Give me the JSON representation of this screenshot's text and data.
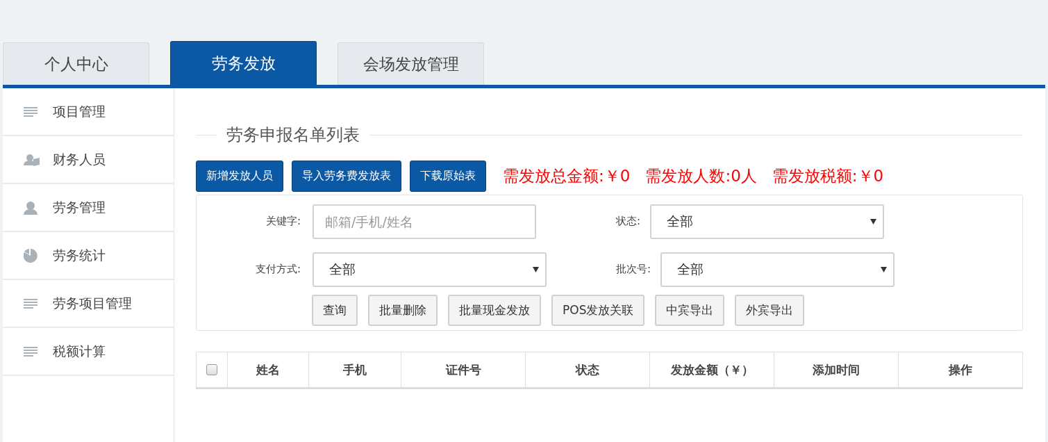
{
  "tabs": [
    {
      "label": "个人中心",
      "selected": false
    },
    {
      "label": "劳务发放",
      "selected": true
    },
    {
      "label": "会场发放管理",
      "selected": false
    }
  ],
  "sidebar": {
    "items": [
      {
        "label": "项目管理"
      },
      {
        "label": "财务人员"
      },
      {
        "label": "劳务管理"
      },
      {
        "label": "劳务统计"
      },
      {
        "label": "劳务项目管理"
      },
      {
        "label": "税额计算"
      }
    ]
  },
  "section_title": "劳务申报名单列表",
  "actions": [
    "新增发放人员",
    "导入劳务费发放表",
    "下载原始表"
  ],
  "summary": [
    "需发放总金额:￥0",
    "需发放人数:0人",
    "需发放税额:￥0"
  ],
  "filters": {
    "rows": [
      [
        {
          "label": "关键字:",
          "kind": "input",
          "placeholder": "邮箱/手机/姓名"
        },
        {
          "label": "状态:",
          "kind": "select",
          "value": "全部"
        }
      ],
      [
        {
          "label": "支付方式:",
          "kind": "select",
          "value": "全部"
        },
        {
          "label": "批次号:",
          "kind": "select",
          "value": "全部"
        }
      ]
    ],
    "buttons": [
      "查询",
      "批量删除",
      "批量现金发放",
      "POS发放关联",
      "中宾导出",
      "外宾导出"
    ]
  },
  "table": {
    "select_all_checked": false,
    "columns": [
      "姓名",
      "手机",
      "证件号",
      "状态",
      "发放金额（￥）",
      "添加时间",
      "操作"
    ]
  }
}
